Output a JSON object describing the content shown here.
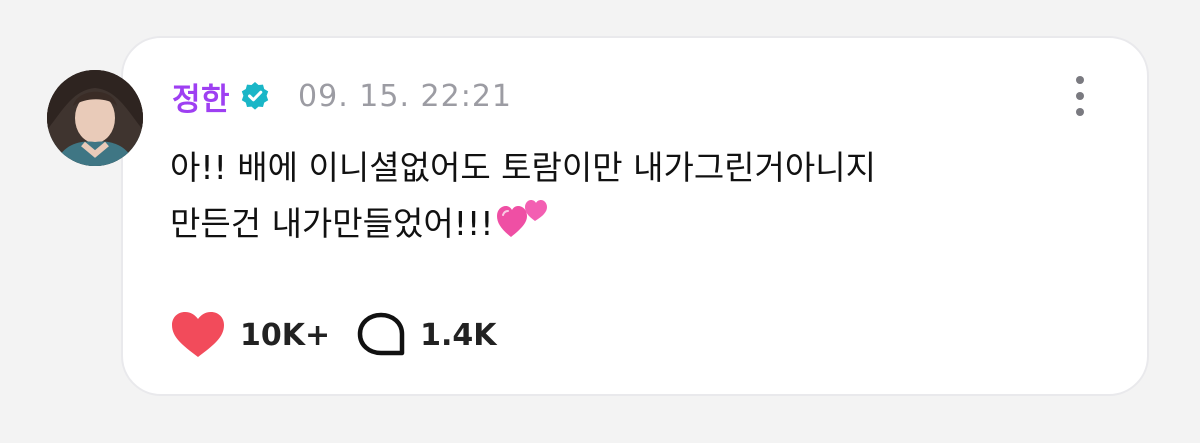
{
  "post": {
    "author": "정한",
    "timestamp": "09. 15. 22:21",
    "text_line1": "아!! 배에 이니셜없어도 토람이만 내가그린거아니지",
    "text_line2": "만든건 내가만들었어!!!",
    "emoji": "two-hearts",
    "likes": "10K+",
    "comments": "1.4K"
  },
  "icons": {
    "verified": "verified-badge-icon",
    "more": "more-vertical-icon",
    "like": "heart-icon",
    "comment": "comment-bubble-icon"
  },
  "colors": {
    "author": "#9e3ff2",
    "verified": "#1ab6c7",
    "heart": "#f24b5b",
    "timestamp": "#9c9ca3"
  }
}
